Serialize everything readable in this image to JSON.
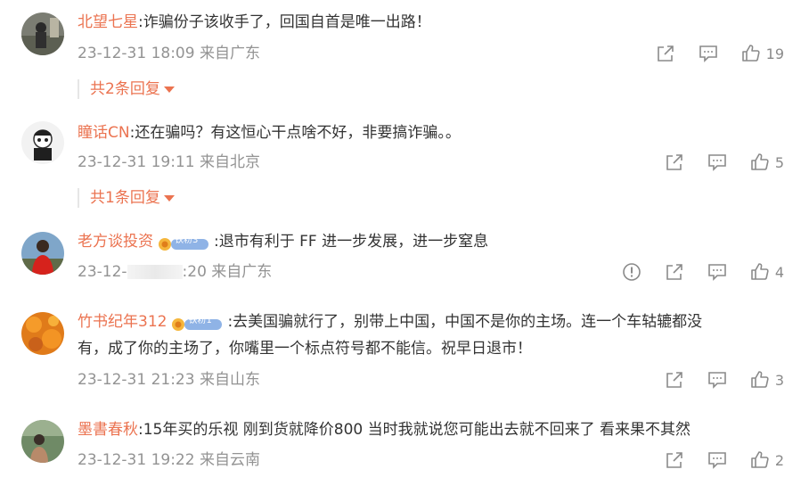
{
  "comments": [
    {
      "username": "北望七星",
      "text": ":诈骗份子该收手了，回国自首是唯一出路！",
      "meta": "23-12-31 18:09 来自广东",
      "likes": "19",
      "replies": "共2条回复",
      "badge": ""
    },
    {
      "username": "瞳话CN",
      "text": ":还在骗吗？有这恒心干点啥不好，非要搞诈骗。。",
      "meta": "23-12-31 19:11 来自北京",
      "likes": "5",
      "replies": "共1条回复",
      "badge": ""
    },
    {
      "username": "老方谈投资",
      "text": ":退市有利于 FF 进一步发展，进一步窒息",
      "meta_prefix": "23-12-",
      "meta_suffix": ":20 来自广东",
      "likes": "4",
      "badge": "铁粉3"
    },
    {
      "username": "竹书纪年312",
      "text_line1": ":去美国骗就行了，别带上中国，中国不是你的主场。连一个车轱辘都没",
      "text_line2": "有，成了你的主场了，你嘴里一个标点符号都不能信。祝早日退市！",
      "meta": "23-12-31 21:23 来自山东",
      "likes": "3",
      "badge": "铁粉1"
    },
    {
      "username": "墨書春秋",
      "text": ":15年买的乐视 刚到货就降价800 当时我就说您可能出去就不回来了 看来果不其然",
      "meta": "23-12-31 19:22 来自云南",
      "likes": "2",
      "badge": ""
    }
  ],
  "colors": {
    "username": "#eb7350",
    "meta": "#939393",
    "badge_bg": "#8fb3e6"
  },
  "icons": [
    "share-icon",
    "comment-icon",
    "like-icon",
    "report-icon"
  ]
}
